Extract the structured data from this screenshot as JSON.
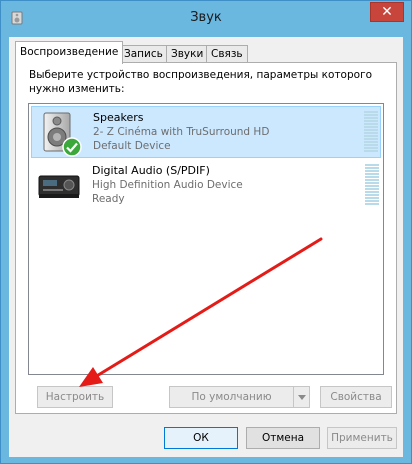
{
  "window": {
    "title": "Звук",
    "close_label": "✕"
  },
  "tabs": [
    {
      "label": "Воспроизведение",
      "active": true
    },
    {
      "label": "Запись",
      "active": false
    },
    {
      "label": "Звуки",
      "active": false
    },
    {
      "label": "Связь",
      "active": false
    }
  ],
  "instruction": "Выберите устройство воспроизведения, параметры которого нужно изменить:",
  "devices": [
    {
      "name": "Speakers",
      "line1": "2- Z Cinéma with TruSurround HD",
      "line2": "Default Device",
      "icon": "speaker-icon",
      "badge": "default-check-icon",
      "selected": true
    },
    {
      "name": "Digital Audio (S/PDIF)",
      "line1": "High Definition Audio Device",
      "line2": "Ready",
      "icon": "receiver-icon",
      "selected": false
    }
  ],
  "panel_buttons": {
    "configure": "Настроить",
    "set_default": "По умолчанию",
    "properties": "Свойства"
  },
  "dialog_buttons": {
    "ok": "ОК",
    "cancel": "Отмена",
    "apply": "Применить"
  },
  "colors": {
    "titlebar": "#6ab7e0",
    "selection": "#cce8ff",
    "annotation_arrow": "#e41b17",
    "check_badge": "#3aa83a"
  }
}
